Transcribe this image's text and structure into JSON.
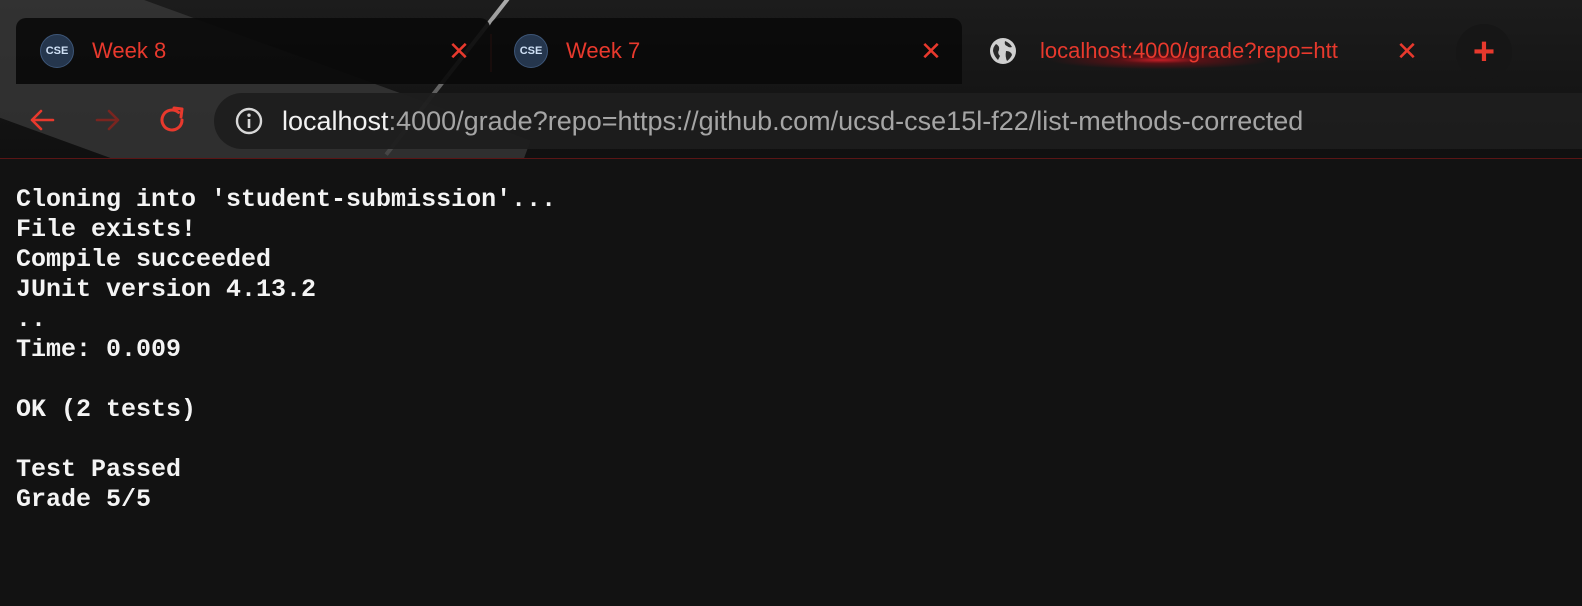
{
  "browser": {
    "tabs": [
      {
        "label": "Week 8",
        "favicon_text": "CSE",
        "active": false
      },
      {
        "label": "Week 7",
        "favicon_text": "CSE",
        "active": false
      },
      {
        "label": "localhost:4000/grade?repo=htt",
        "favicon": "globe-icon",
        "active": true
      }
    ],
    "tab_close_symbol": "✕",
    "new_tab_symbol": "+",
    "address_bar": {
      "host": "localhost",
      "rest": ":4000/grade?repo=https://github.com/ucsd-cse15l-f22/list-methods-corrected"
    },
    "icons": {
      "back": "arrow-left-icon",
      "forward": "arrow-right-icon",
      "reload": "reload-icon",
      "site_info": "info-icon"
    },
    "accent_color": "#e8392d"
  },
  "page": {
    "lines": [
      "Cloning into 'student-submission'...",
      "File exists!",
      "Compile succeeded",
      "JUnit version 4.13.2",
      "..",
      "Time: 0.009",
      "",
      "OK (2 tests)",
      "",
      "Test Passed",
      "Grade 5/5"
    ]
  }
}
